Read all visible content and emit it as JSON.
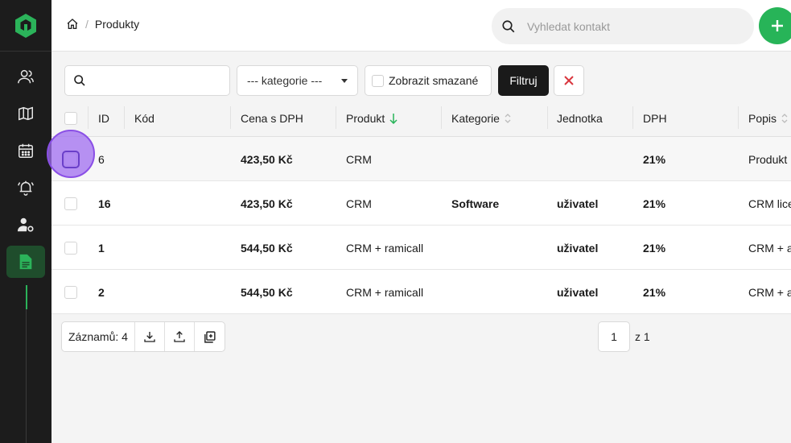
{
  "header": {
    "breadcrumb_current": "Produkty",
    "breadcrumb_sep": "/",
    "search_placeholder": "Vyhledat kontakt"
  },
  "filters": {
    "search_value": "",
    "category_selected": "--- kategorie ---",
    "show_deleted_label": "Zobrazit smazané",
    "filter_button": "Filtruj"
  },
  "table": {
    "columns": [
      {
        "label": "ID"
      },
      {
        "label": "Kód"
      },
      {
        "label": "Cena s DPH"
      },
      {
        "label": "Produkt"
      },
      {
        "label": "Kategorie"
      },
      {
        "label": "Jednotka"
      },
      {
        "label": "DPH"
      },
      {
        "label": "Popis"
      }
    ],
    "rows": [
      {
        "id": "6",
        "code": "",
        "price": "423,50 Kč",
        "product": "CRM",
        "category": "",
        "unit": "",
        "vat": "21%",
        "desc": "Produkt"
      },
      {
        "id": "16",
        "code": "",
        "price": "423,50 Kč",
        "product": "CRM",
        "category": "Software",
        "unit": "uživatel",
        "vat": "21%",
        "desc": "CRM lice"
      },
      {
        "id": "1",
        "code": "",
        "price": "544,50 Kč",
        "product": "CRM + ramicall",
        "category": "",
        "unit": "uživatel",
        "vat": "21%",
        "desc": "CRM + a"
      },
      {
        "id": "2",
        "code": "",
        "price": "544,50 Kč",
        "product": "CRM + ramicall",
        "category": "",
        "unit": "uživatel",
        "vat": "21%",
        "desc": "CRM + a"
      }
    ]
  },
  "footer": {
    "records_label": "Záznamů: 4",
    "page_value": "1",
    "page_of": "z 1"
  },
  "colors": {
    "accent": "#27b458",
    "sidebar_bg": "#1c1c1c",
    "danger": "#d9363e",
    "highlight": "#8a4fe6"
  },
  "icons": [
    "home-icon",
    "search-icon",
    "plus-icon",
    "users-icon",
    "map-icon",
    "calendar-icon",
    "bell-icon",
    "user-settings-icon",
    "document-icon",
    "close-icon",
    "download-icon",
    "upload-icon",
    "duplicate-icon",
    "chevron-down-icon"
  ]
}
